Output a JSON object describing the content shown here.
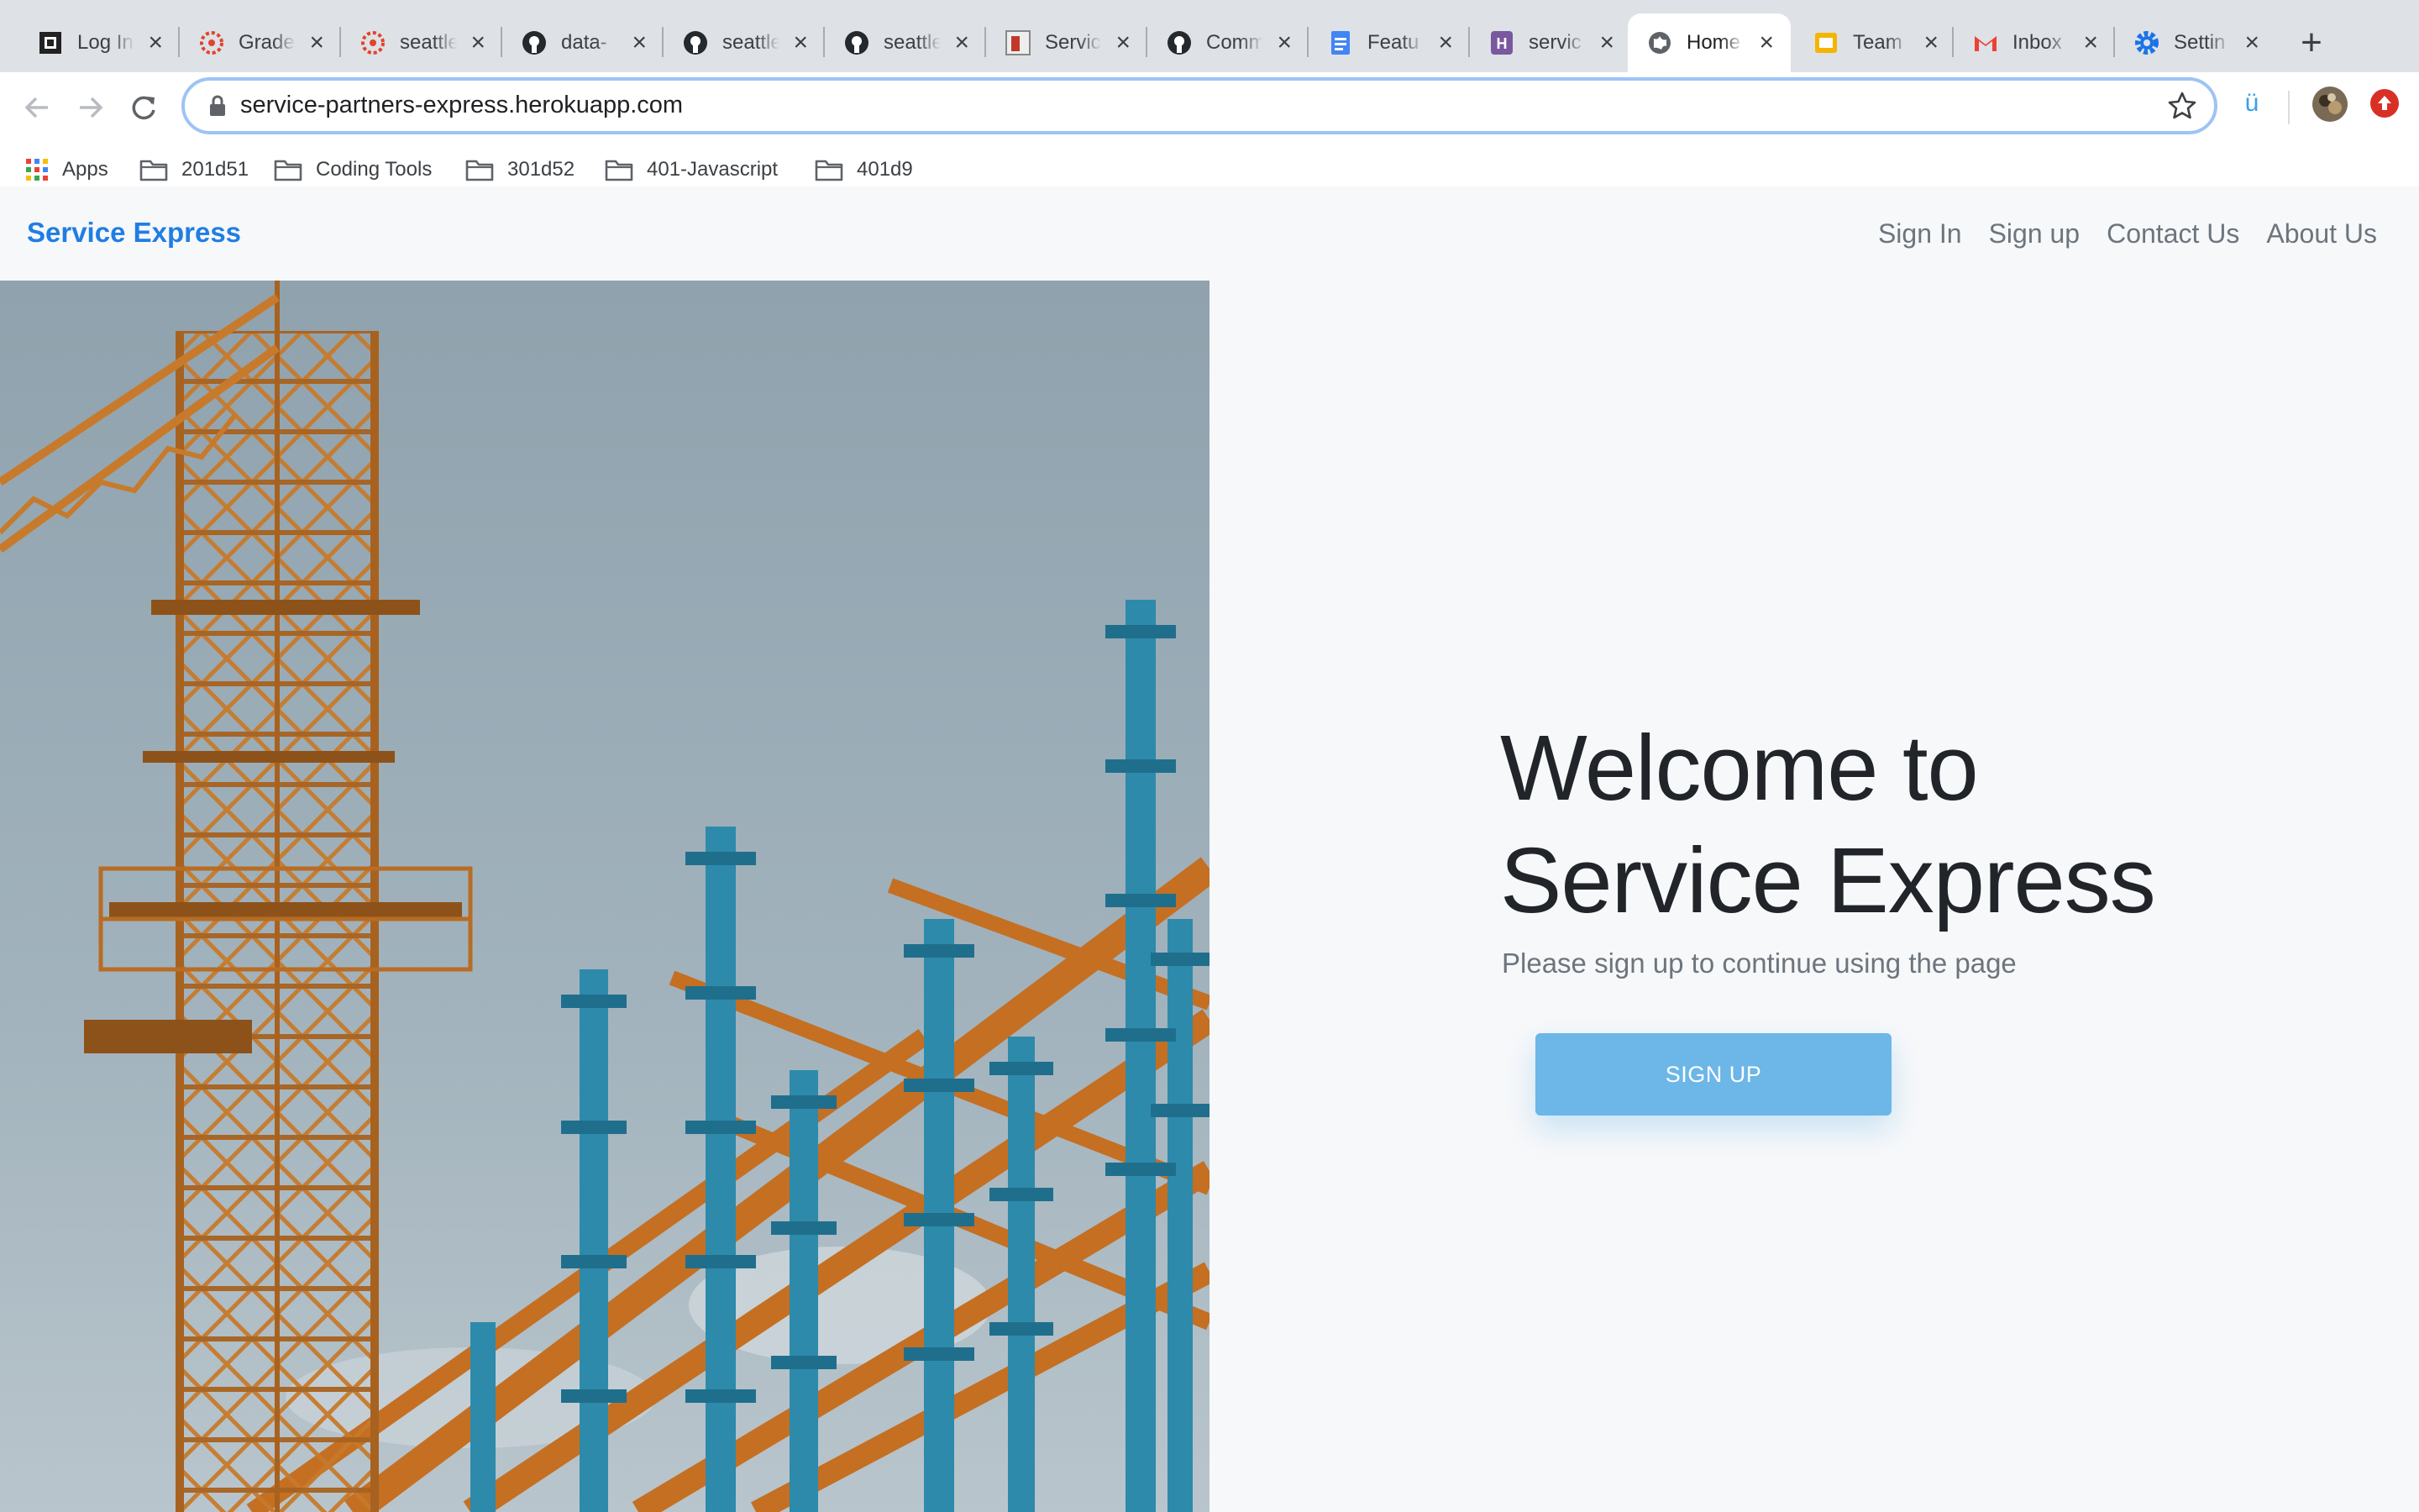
{
  "browser": {
    "tabs": [
      {
        "title": "Log In",
        "icon": "square-logo-icon",
        "active": false
      },
      {
        "title": "Grades",
        "icon": "canvas-icon",
        "active": false
      },
      {
        "title": "seattle",
        "icon": "canvas-icon",
        "active": false
      },
      {
        "title": "data-",
        "icon": "github-icon",
        "active": false
      },
      {
        "title": "seattle",
        "icon": "github-icon",
        "active": false
      },
      {
        "title": "seattle",
        "icon": "github-icon",
        "active": false
      },
      {
        "title": "Service",
        "icon": "service-icon",
        "active": false
      },
      {
        "title": "Comm",
        "icon": "github-icon",
        "active": false
      },
      {
        "title": "Featu",
        "icon": "docs-icon",
        "active": false
      },
      {
        "title": "servic",
        "icon": "heroku-icon",
        "active": false
      },
      {
        "title": "Home",
        "icon": "globe-icon",
        "active": true
      },
      {
        "title": "Team",
        "icon": "slides-icon",
        "active": false
      },
      {
        "title": "Inbox",
        "icon": "gmail-icon",
        "active": false
      },
      {
        "title": "Settin",
        "icon": "gear-icon",
        "active": false
      }
    ],
    "url": "service-partners-express.herokuapp.com",
    "bookmarks": [
      {
        "label": "Apps",
        "icon": "apps-grid-icon"
      },
      {
        "label": "201d51",
        "icon": "folder-icon"
      },
      {
        "label": "Coding Tools",
        "icon": "folder-icon"
      },
      {
        "label": "301d52",
        "icon": "folder-icon"
      },
      {
        "label": "401-Javascript",
        "icon": "folder-icon"
      },
      {
        "label": "401d9",
        "icon": "folder-icon"
      }
    ]
  },
  "site": {
    "brand": "Service Express",
    "nav": [
      {
        "label": "Sign In"
      },
      {
        "label": "Sign up"
      },
      {
        "label": "Contact Us"
      },
      {
        "label": "About Us"
      }
    ],
    "hero": {
      "title_line1": "Welcome to",
      "title_line2": "Service Express",
      "subtitle": "Please sign up to continue using the page",
      "button": "SIGN UP"
    }
  },
  "colors": {
    "brand": "#1f7ee4",
    "button": "#6cb6e8",
    "page_bg": "#f7f8fa",
    "crane": "#c97a2e",
    "steel_blue": "#2f8fb0"
  }
}
